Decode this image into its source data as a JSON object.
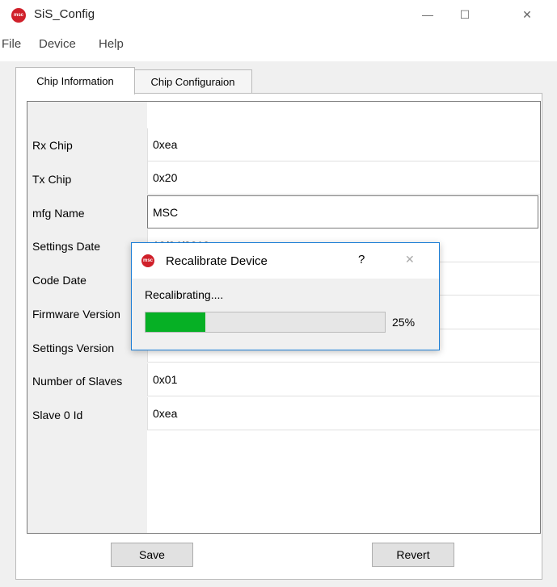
{
  "window": {
    "title": "SiS_Config",
    "icon_label": "msc",
    "minimize": "—",
    "maximize": "☐",
    "close": "✕"
  },
  "menu": [
    "File",
    "Device",
    "Help"
  ],
  "tabs": [
    {
      "label": "Chip Information",
      "active": true
    },
    {
      "label": "Chip Configuraion",
      "active": false
    }
  ],
  "rows": [
    {
      "label": "Rx Chip",
      "value": "0xea"
    },
    {
      "label": "Tx Chip",
      "value": "0x20"
    },
    {
      "label": "mfg Name",
      "value": "MSC"
    },
    {
      "label": "Settings Date",
      "value": "10/04/2019"
    },
    {
      "label": "Code Date",
      "value": ""
    },
    {
      "label": "Firmware Version",
      "value": ""
    },
    {
      "label": "Settings Version",
      "value": "..."
    },
    {
      "label": "Number of Slaves",
      "value": "0x01"
    },
    {
      "label": "Slave 0 Id",
      "value": "0xea"
    }
  ],
  "buttons": {
    "save": "Save",
    "revert": "Revert"
  },
  "dialog": {
    "title": "Recalibrate Device",
    "icon_label": "msc",
    "help": "?",
    "close": "✕",
    "status": "Recalibrating....",
    "progress_percent": 25,
    "progress_text": "25%"
  },
  "colors": {
    "progress": "#06b025",
    "dialog_border": "#1c7ed6",
    "brand": "#d0202a"
  }
}
